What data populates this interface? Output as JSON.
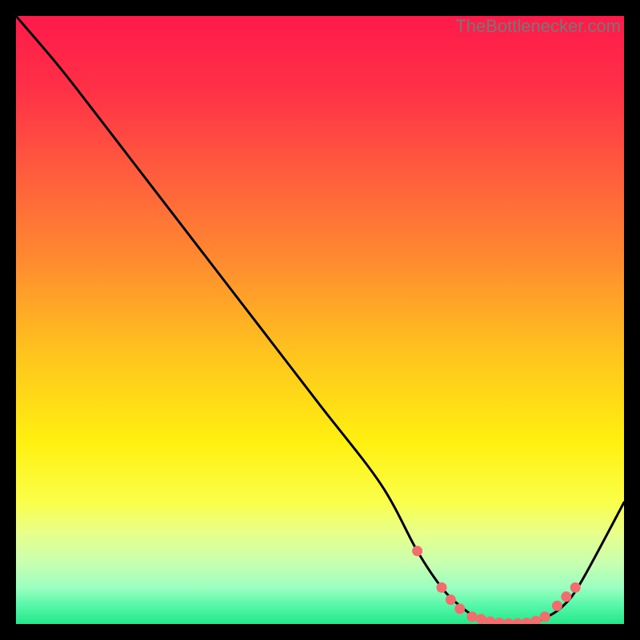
{
  "attribution": "TheBottlenecker.com",
  "chart_data": {
    "type": "line",
    "title": "",
    "xlabel": "",
    "ylabel": "",
    "xlim": [
      0,
      100
    ],
    "ylim": [
      0,
      100
    ],
    "background_gradient": {
      "stops": [
        {
          "offset": 0,
          "color": "#ff1a4a"
        },
        {
          "offset": 12,
          "color": "#ff3047"
        },
        {
          "offset": 25,
          "color": "#ff5a3e"
        },
        {
          "offset": 40,
          "color": "#ff8a30"
        },
        {
          "offset": 55,
          "color": "#ffc21e"
        },
        {
          "offset": 70,
          "color": "#fff010"
        },
        {
          "offset": 80,
          "color": "#faff4a"
        },
        {
          "offset": 85,
          "color": "#e8ff8a"
        },
        {
          "offset": 90,
          "color": "#c8ffb0"
        },
        {
          "offset": 94,
          "color": "#9affc0"
        },
        {
          "offset": 97,
          "color": "#55f7a8"
        },
        {
          "offset": 100,
          "color": "#25e88a"
        }
      ]
    },
    "series": [
      {
        "name": "bottleneck-curve",
        "color": "#000000",
        "x": [
          0,
          6,
          10,
          20,
          30,
          40,
          50,
          60,
          66,
          70,
          73,
          76,
          80,
          84,
          87,
          90,
          93,
          100
        ],
        "y": [
          100,
          93,
          88,
          75,
          62,
          49,
          36,
          23,
          12,
          6,
          3,
          1,
          0,
          0,
          1,
          3,
          7,
          20
        ]
      }
    ],
    "markers": {
      "name": "bottleneck-markers",
      "color": "#f26d6d",
      "points": [
        {
          "x": 66,
          "y": 12
        },
        {
          "x": 70,
          "y": 6
        },
        {
          "x": 71.5,
          "y": 4
        },
        {
          "x": 73,
          "y": 2.5
        },
        {
          "x": 75,
          "y": 1.2
        },
        {
          "x": 76.5,
          "y": 0.8
        },
        {
          "x": 78,
          "y": 0.4
        },
        {
          "x": 79.5,
          "y": 0.2
        },
        {
          "x": 81,
          "y": 0.1
        },
        {
          "x": 82.5,
          "y": 0.1
        },
        {
          "x": 84,
          "y": 0.2
        },
        {
          "x": 85.5,
          "y": 0.5
        },
        {
          "x": 87,
          "y": 1.2
        },
        {
          "x": 89,
          "y": 3
        },
        {
          "x": 90.5,
          "y": 4.5
        },
        {
          "x": 92,
          "y": 6
        }
      ]
    }
  }
}
